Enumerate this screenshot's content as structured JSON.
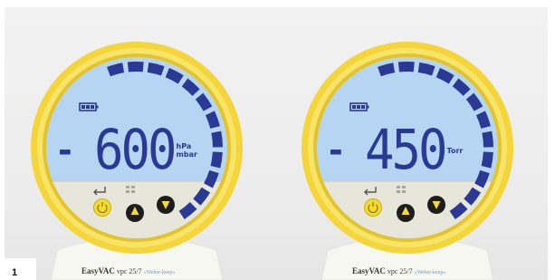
{
  "figure_label": "1",
  "gauges": [
    {
      "minus": "-",
      "value": "600",
      "unit_top": "hPa",
      "unit_bottom": "mbar",
      "brand_name": "EasyVAC",
      "brand_model": "vpc 25/7",
      "brand_tag": "»Weber-keep«",
      "bar_segments_lit": 12
    },
    {
      "minus": "-",
      "value": "450",
      "unit_top": "Torr",
      "unit_bottom": "",
      "brand_name": "EasyVAC",
      "brand_model": "vpc 25/7",
      "brand_tag": "»Weber-keep«",
      "bar_segments_lit": 12
    }
  ],
  "colors": {
    "bezel": "#f5d73a",
    "lcd": "#b3d3f2",
    "segments": "#2a3a94",
    "button_power": "#f3da33",
    "button_dark": "#1d1d1d"
  },
  "icons": [
    "battery-icon",
    "enter-icon",
    "power-icon",
    "arrow-up-icon",
    "arrow-down-icon"
  ]
}
